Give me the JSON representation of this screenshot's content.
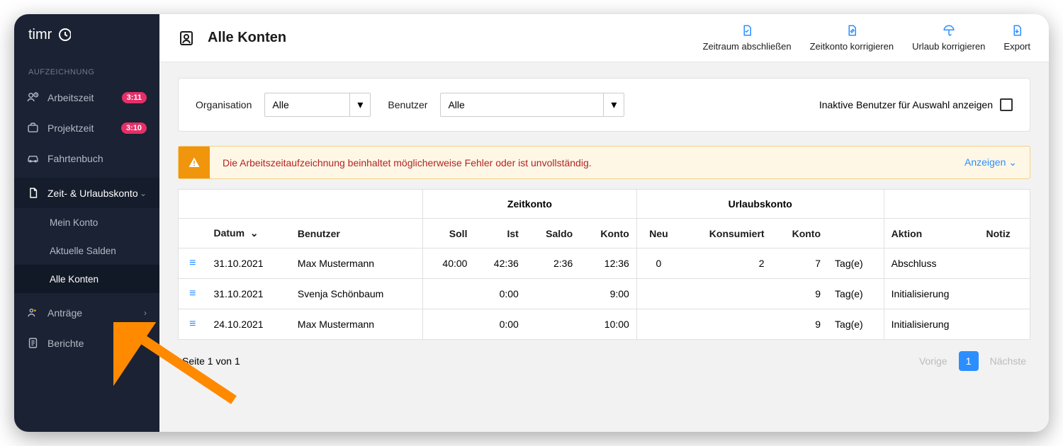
{
  "brand": "timr",
  "sidebar": {
    "section_label": "AUFZEICHNUNG",
    "arbeitszeit": {
      "label": "Arbeitszeit",
      "badge": "3:11"
    },
    "projektzeit": {
      "label": "Projektzeit",
      "badge": "3:10"
    },
    "fahrtenbuch": {
      "label": "Fahrtenbuch"
    },
    "zeit_urlaub": {
      "label": "Zeit- & Urlaubskonto"
    },
    "sub": {
      "mein_konto": "Mein Konto",
      "aktuelle_salden": "Aktuelle Salden",
      "alle_konten": "Alle Konten"
    },
    "antraege": {
      "label": "Anträge"
    },
    "berichte": {
      "label": "Berichte"
    }
  },
  "header": {
    "title": "Alle Konten",
    "actions": {
      "zeitraum": "Zeitraum abschließen",
      "zeitkonto": "Zeitkonto korrigieren",
      "urlaub": "Urlaub korrigieren",
      "export": "Export"
    }
  },
  "filter": {
    "org_label": "Organisation",
    "org_value": "Alle",
    "user_label": "Benutzer",
    "user_value": "Alle",
    "inactive_label": "Inaktive Benutzer für Auswahl anzeigen"
  },
  "warning": {
    "text": "Die Arbeitszeitaufzeichnung beinhaltet möglicherweise Fehler oder ist unvollständig.",
    "link": "Anzeigen"
  },
  "table": {
    "group": {
      "zeitkonto": "Zeitkonto",
      "urlaubskonto": "Urlaubskonto"
    },
    "headers": {
      "datum": "Datum",
      "benutzer": "Benutzer",
      "soll": "Soll",
      "ist": "Ist",
      "saldo": "Saldo",
      "konto": "Konto",
      "neu": "Neu",
      "konsumiert": "Konsumiert",
      "u_konto": "Konto",
      "aktion": "Aktion",
      "notiz": "Notiz"
    },
    "unit": "Tag(e)",
    "rows": [
      {
        "datum": "31.10.2021",
        "benutzer": "Max Mustermann",
        "soll": "40:00",
        "ist": "42:36",
        "saldo": "2:36",
        "konto": "12:36",
        "neu": "0",
        "konsumiert": "2",
        "u_konto": "7",
        "aktion": "Abschluss",
        "notiz": ""
      },
      {
        "datum": "31.10.2021",
        "benutzer": "Svenja Schönbaum",
        "soll": "",
        "ist": "0:00",
        "saldo": "",
        "konto": "9:00",
        "neu": "",
        "konsumiert": "",
        "u_konto": "9",
        "aktion": "Initialisierung",
        "notiz": ""
      },
      {
        "datum": "24.10.2021",
        "benutzer": "Max Mustermann",
        "soll": "",
        "ist": "0:00",
        "saldo": "",
        "konto": "10:00",
        "neu": "",
        "konsumiert": "",
        "u_konto": "9",
        "aktion": "Initialisierung",
        "notiz": ""
      }
    ]
  },
  "pager": {
    "status": "Seite 1 von 1",
    "prev": "Vorige",
    "page": "1",
    "next": "Nächste"
  }
}
